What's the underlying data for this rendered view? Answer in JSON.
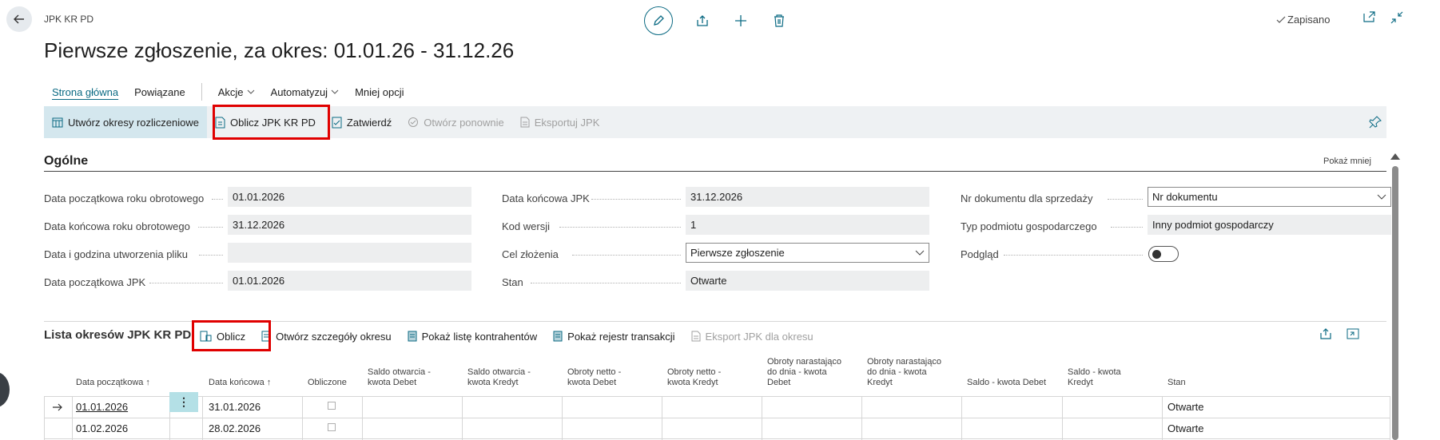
{
  "header": {
    "breadcrumb": "JPK KR PD",
    "title": "Pierwsze zgłoszenie, za okres: 01.01.26 - 31.12.26",
    "saved_label": "Zapisano"
  },
  "nav": {
    "tabs": [
      {
        "label": "Strona główna"
      },
      {
        "label": "Powiązane"
      },
      {
        "label": "Akcje"
      },
      {
        "label": "Automatyzuj"
      },
      {
        "label": "Mniej opcji"
      }
    ]
  },
  "actions": {
    "create_periods": "Utwórz okresy rozliczeniowe",
    "calculate": "Oblicz JPK KR PD",
    "approve": "Zatwierdź",
    "reopen": "Otwórz ponownie",
    "export": "Eksportuj JPK"
  },
  "general": {
    "title": "Ogólne",
    "show_less": "Pokaż mniej",
    "fields": {
      "fy_start_label": "Data początkowa roku obrotowego",
      "fy_start_value": "01.01.2026",
      "fy_end_label": "Data końcowa roku obrotowego",
      "fy_end_value": "31.12.2026",
      "created_label": "Data i godzina utworzenia pliku",
      "created_value": "",
      "jpk_start_label": "Data początkowa JPK",
      "jpk_start_value": "01.01.2026",
      "jpk_end_label": "Data końcowa JPK",
      "jpk_end_value": "31.12.2026",
      "version_label": "Kod wersji",
      "version_value": "1",
      "purpose_label": "Cel złożenia",
      "purpose_value": "Pierwsze zgłoszenie",
      "status_label": "Stan",
      "status_value": "Otwarte",
      "sales_doc_label": "Nr dokumentu dla sprzedaży",
      "sales_doc_value": "Nr dokumentu",
      "entity_type_label": "Typ podmiotu gospodarczego",
      "entity_type_value": "Inny podmiot gospodarczy",
      "preview_label": "Podgląd"
    }
  },
  "periods": {
    "title": "Lista okresów JPK KR PD",
    "actions": {
      "calculate": "Oblicz",
      "open_details": "Otwórz szczegóły okresu",
      "show_contractors": "Pokaż listę kontrahentów",
      "show_register": "Pokaż rejestr transakcji",
      "export_period": "Eksport JPK dla okresu"
    },
    "columns": {
      "start": "Data początkowa ↑",
      "end": "Data końcowa ↑",
      "calculated": "Obliczone",
      "open_debit_1": "Saldo otwarcia -",
      "open_debit_2": "kwota Debet",
      "open_credit_1": "Saldo otwarcia -",
      "open_credit_2": "kwota Kredyt",
      "net_debit_1": "Obroty netto -",
      "net_debit_2": "kwota Debet",
      "net_credit_1": "Obroty netto -",
      "net_credit_2": "kwota Kredyt",
      "cum_debit_1": "Obroty narastająco",
      "cum_debit_2": "do dnia - kwota",
      "cum_debit_3": "Debet",
      "cum_credit_1": "Obroty narastająco",
      "cum_credit_2": "do dnia - kwota",
      "cum_credit_3": "Kredyt",
      "bal_debit": "Saldo - kwota Debet",
      "bal_credit_1": "Saldo - kwota",
      "bal_credit_2": "Kredyt",
      "status": "Stan"
    },
    "rows": [
      {
        "start": "01.01.2026",
        "end": "31.01.2026",
        "status": "Otwarte"
      },
      {
        "start": "01.02.2026",
        "end": "28.02.2026",
        "status": "Otwarte"
      }
    ]
  }
}
